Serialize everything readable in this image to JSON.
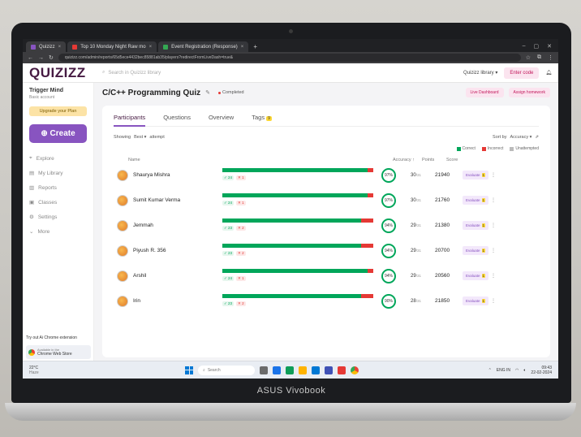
{
  "browser": {
    "tabs": [
      {
        "label": "Quizizz",
        "active": true
      },
      {
        "label": "Top 10 Monday Night Raw mo",
        "active": false
      },
      {
        "label": "Event Registration (Response)",
        "active": false
      }
    ],
    "url": "quizizz.com/admin/reports/65d5ece4432bec85881ab35/players?redirectFromLiveDash=true&"
  },
  "header": {
    "logo": "QUIZIZZ",
    "search_placeholder": "Search in Quizizz library",
    "library_label": "Quizizz library ▾",
    "enter_code": "Enter code"
  },
  "sidebar": {
    "org_name": "Trigger Mind",
    "org_sub": "Basic account",
    "upgrade": "Upgrade your Plan",
    "create": "Create",
    "items": [
      {
        "label": "Explore",
        "icon": "compass-icon"
      },
      {
        "label": "My Library",
        "icon": "library-icon"
      },
      {
        "label": "Reports",
        "icon": "reports-icon"
      },
      {
        "label": "Classes",
        "icon": "classes-icon"
      },
      {
        "label": "Settings",
        "icon": "gear-icon"
      },
      {
        "label": "More",
        "icon": "chevron-down-icon"
      }
    ],
    "extension": {
      "title": "Try out Ai Chrome extension",
      "sub": "Available in the",
      "store": "Chrome Web Store"
    }
  },
  "main": {
    "title": "C/C++ Programming Quiz",
    "status": "Completed",
    "live_dashboard": "Live Dashboard",
    "assign_homework": "Assign homework",
    "tabs": {
      "participants": "Participants",
      "questions": "Questions",
      "overview": "Overview",
      "tags": "Tags",
      "tags_count": "9"
    },
    "filter": {
      "showing": "Showing",
      "value": "Best",
      "attempt": "attempt",
      "sort_label": "Sort by",
      "sort_value": "Accuracy"
    },
    "legend": {
      "correct": "Correct",
      "incorrect": "Incorrect",
      "unattempted": "Unattempted"
    },
    "columns": {
      "name": "Name",
      "accuracy": "Accuracy ↑",
      "points": "Points",
      "score": "Score"
    },
    "rows": [
      {
        "name": "Shaurya Mishra",
        "correct": "24",
        "incorrect": "1",
        "ratio": 0.96,
        "accuracy": "97%",
        "points": "30",
        "points_total": "/31",
        "score": "21940",
        "evaluate": "Evaluate",
        "eval_badge": "1"
      },
      {
        "name": "Sumit Kumar Verma",
        "correct": "24",
        "incorrect": "1",
        "ratio": 0.96,
        "accuracy": "97%",
        "points": "30",
        "points_total": "/31",
        "score": "21760",
        "evaluate": "Evaluate",
        "eval_badge": "1"
      },
      {
        "name": "Jemmah",
        "correct": "23",
        "incorrect": "2",
        "ratio": 0.92,
        "accuracy": "94%",
        "points": "29",
        "points_total": "/31",
        "score": "21380",
        "evaluate": "Evaluate",
        "eval_badge": "1"
      },
      {
        "name": "Piyush R. 356",
        "correct": "23",
        "incorrect": "2",
        "ratio": 0.92,
        "accuracy": "94%",
        "points": "29",
        "points_total": "/31",
        "score": "20700",
        "evaluate": "Evaluate",
        "eval_badge": "1"
      },
      {
        "name": "Arshil",
        "correct": "24",
        "incorrect": "1",
        "ratio": 0.96,
        "accuracy": "94%",
        "points": "29",
        "points_total": "/31",
        "score": "20560",
        "evaluate": "Evaluate",
        "eval_badge": "1"
      },
      {
        "name": "Irin",
        "correct": "23",
        "incorrect": "2",
        "ratio": 0.92,
        "accuracy": "90%",
        "points": "28",
        "points_total": "/31",
        "score": "21850",
        "evaluate": "Evaluate",
        "eval_badge": "1"
      }
    ]
  },
  "taskbar": {
    "weather_temp": "22°C",
    "weather_desc": "Haze",
    "search": "Search",
    "lang": "ENG IN",
    "time": "09:43",
    "date": "22-02-2024"
  },
  "laptop_brand": "ASUS Vivobook",
  "colors": {
    "correct": "#00a65a",
    "incorrect": "#e53935",
    "accent": "#8854c0"
  }
}
